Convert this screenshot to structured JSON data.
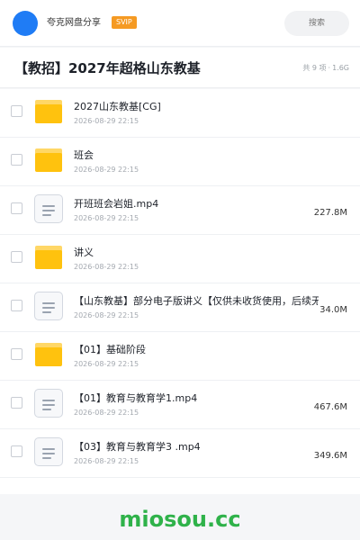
{
  "header": {
    "brand": "夸克网盘分享",
    "badge": "SVIP",
    "search_placeholder": "搜索",
    "avatar_color": "#1f7cf5"
  },
  "share": {
    "title": "【教招】2027年超格山东教基",
    "item_count": "共 9 项",
    "separator": "·",
    "total_size": "1.6G"
  },
  "files": [
    {
      "type": "folder",
      "name": "2027山东教基[CG]",
      "date": "2026-08-29 22:15",
      "size": ""
    },
    {
      "type": "folder",
      "name": "班会",
      "date": "2026-08-29 22:15",
      "size": ""
    },
    {
      "type": "file",
      "name": "开班班会岩姐.mp4",
      "date": "2026-08-29 22:15",
      "size": "227.8M"
    },
    {
      "type": "folder",
      "name": "讲义",
      "date": "2026-08-29 22:15",
      "size": ""
    },
    {
      "type": "file",
      "name": "【山东教基】部分电子版讲义【仅供未收货使用，后续无",
      "date": "2026-08-29 22:15",
      "size": "34.0M"
    },
    {
      "type": "folder",
      "name": "【01】基础阶段",
      "date": "2026-08-29 22:15",
      "size": ""
    },
    {
      "type": "file",
      "name": "【01】教育与教育学1.mp4",
      "date": "2026-08-29 22:15",
      "size": "467.6M"
    },
    {
      "type": "file",
      "name": "【03】教育与教育学3 .mp4",
      "date": "2026-08-29 22:15",
      "size": "349.6M"
    }
  ],
  "watermark": "miosou.cc",
  "colors": {
    "folder": "#ffc20e",
    "badge": "#f59a23",
    "watermark": "#2fb24a"
  }
}
